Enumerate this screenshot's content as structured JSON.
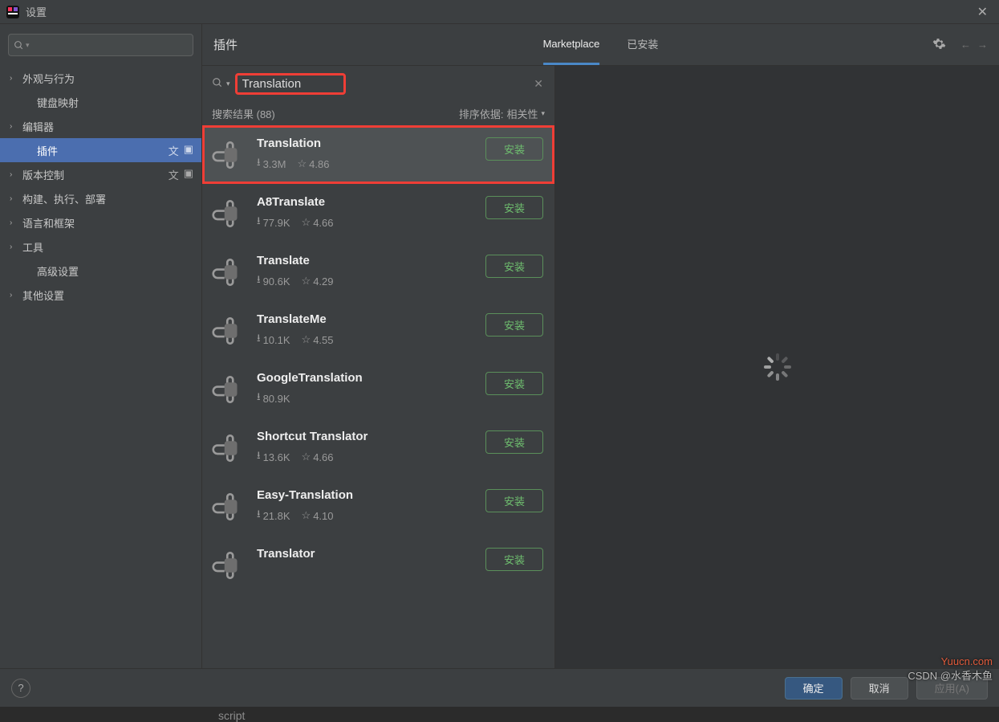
{
  "window": {
    "title": "设置",
    "close_hint": "关闭"
  },
  "left_search": {
    "placeholder": ""
  },
  "tree": {
    "items": [
      {
        "label": "外观与行为",
        "kind": "branch"
      },
      {
        "label": "键盘映射",
        "kind": "leaf"
      },
      {
        "label": "编辑器",
        "kind": "branch"
      },
      {
        "label": "插件",
        "kind": "leaf",
        "selected": true,
        "badges": true
      },
      {
        "label": "版本控制",
        "kind": "branch",
        "badges": true
      },
      {
        "label": "构建、执行、部署",
        "kind": "branch"
      },
      {
        "label": "语言和框架",
        "kind": "branch"
      },
      {
        "label": "工具",
        "kind": "branch"
      },
      {
        "label": "高级设置",
        "kind": "leaf"
      },
      {
        "label": "其他设置",
        "kind": "branch"
      }
    ]
  },
  "header": {
    "title": "插件",
    "tabs": [
      {
        "label": "Marketplace",
        "active": true
      },
      {
        "label": "已安装",
        "active": false
      }
    ]
  },
  "search": {
    "value": "Translation"
  },
  "results": {
    "label": "搜索结果 (88)",
    "sort_prefix": "排序依据:",
    "sort_value": "相关性"
  },
  "install_label": "安装",
  "plugins": [
    {
      "name": "Translation",
      "downloads": "3.3M",
      "rating": "4.86",
      "selected": true,
      "highlighted": true
    },
    {
      "name": "A8Translate",
      "downloads": "77.9K",
      "rating": "4.66"
    },
    {
      "name": "Translate",
      "downloads": "90.6K",
      "rating": "4.29"
    },
    {
      "name": "TranslateMe",
      "downloads": "10.1K",
      "rating": "4.55"
    },
    {
      "name": "GoogleTranslation",
      "downloads": "80.9K"
    },
    {
      "name": "Shortcut Translator",
      "downloads": "13.6K",
      "rating": "4.66"
    },
    {
      "name": "Easy-Translation",
      "downloads": "21.8K",
      "rating": "4.10"
    },
    {
      "name": "Translator",
      "downloads": ""
    }
  ],
  "footer": {
    "ok": "确定",
    "cancel": "取消",
    "apply": "应用(A)"
  },
  "watermark": {
    "line1": "Yuucn.com",
    "line2": "CSDN @水香木鱼"
  },
  "stray": "script"
}
